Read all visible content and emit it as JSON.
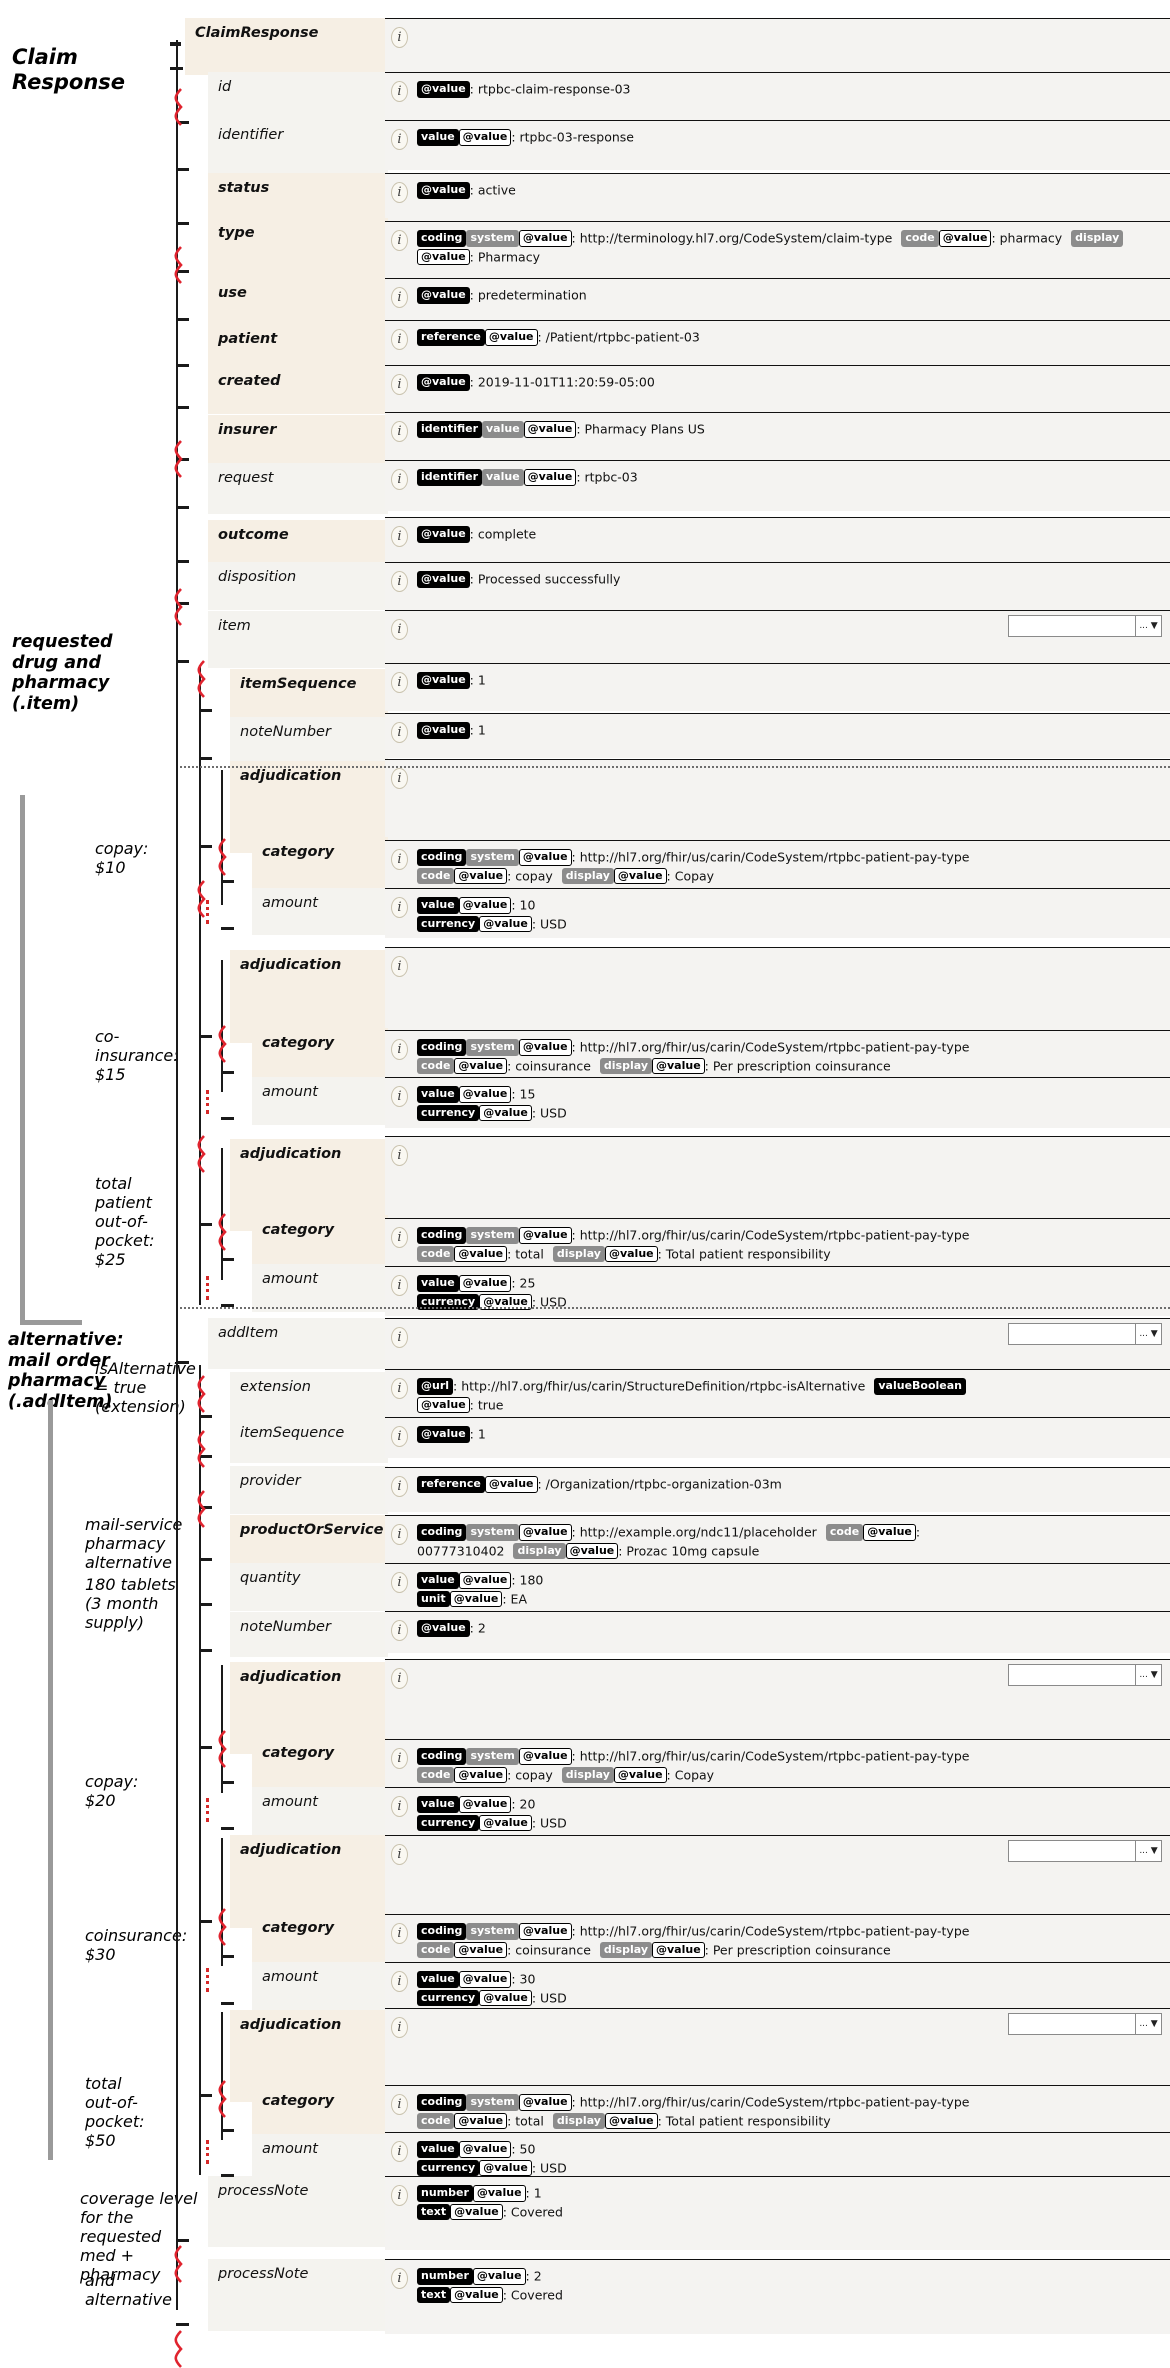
{
  "title": "ClaimResponse FHIR resource tree",
  "annotations": [
    {
      "id": "claim-response",
      "text": "Claim\nResponse",
      "size": "big"
    },
    {
      "id": "requested-drug",
      "text": "requested\ndrug and\npharmacy\n(.item)",
      "size": "mid"
    },
    {
      "id": "copay-10",
      "text": "copay:\n$10",
      "size": "sub"
    },
    {
      "id": "coinsurance-15",
      "text": "co-\ninsurance:\n$15",
      "size": "sub"
    },
    {
      "id": "total-oop-25",
      "text": "total\npatient\nout-of-\npocket:\n$25",
      "size": "sub"
    },
    {
      "id": "alternative",
      "text": "alternative:\nmail order\npharmacy\n(.addItem)",
      "size": "mid"
    },
    {
      "id": "is-alternative",
      "text": "isAlternative\n= true\n(extension)",
      "size": "sub"
    },
    {
      "id": "mail-service",
      "text": "mail-service\npharmacy\nalternative",
      "size": "sub"
    },
    {
      "id": "tablets-180",
      "text": "180 tablets\n(3 month\nsupply)",
      "size": "sub"
    },
    {
      "id": "copay-20",
      "text": "copay:\n$20",
      "size": "sub"
    },
    {
      "id": "coinsurance-30",
      "text": "coinsurance:\n$30",
      "size": "sub"
    },
    {
      "id": "total-oop-50",
      "text": "total\nout-of-\npocket:\n$50",
      "size": "sub"
    },
    {
      "id": "coverage-level",
      "text": "coverage level\nfor the\nrequested\nmed + pharmacy",
      "size": "sub"
    },
    {
      "id": "and-alternative",
      "text": "and\nalternative",
      "size": "sub"
    }
  ],
  "icons": {
    "info": "i",
    "dropdown_arrow": "... ▼"
  },
  "colors": {
    "badge_element": "#000000",
    "badge_attribute": "#8c8c8c",
    "badge_value_border": "#000000",
    "row_required": "#f6efe4",
    "row_optional": "#f4f3ef",
    "squiggle": "#d62828"
  },
  "rows": [
    {
      "name": "ClaimResponse",
      "style": "hdr",
      "parts": []
    },
    {
      "name": "id",
      "style": "opt",
      "parts": [
        {
          "t": "el",
          "v": "@value"
        },
        {
          "t": "txt",
          "v": ": rtpbc-claim-response-03"
        }
      ]
    },
    {
      "name": "identifier",
      "style": "opt",
      "parts": [
        {
          "t": "el",
          "v": "value"
        },
        {
          "t": "va",
          "v": "@value"
        },
        {
          "t": "txt",
          "v": ": rtpbc-03-response"
        }
      ]
    },
    {
      "name": "status",
      "style": "req",
      "parts": [
        {
          "t": "el",
          "v": "@value"
        },
        {
          "t": "txt",
          "v": ": active"
        }
      ]
    },
    {
      "name": "type",
      "style": "req",
      "parts": [
        {
          "t": "el",
          "v": "coding"
        },
        {
          "t": "at",
          "v": "system"
        },
        {
          "t": "va",
          "v": "@value"
        },
        {
          "t": "txt",
          "v": ": http://terminology.hl7.org/CodeSystem/claim-type"
        },
        {
          "t": "sep"
        },
        {
          "t": "at",
          "v": "code"
        },
        {
          "t": "va",
          "v": "@value"
        },
        {
          "t": "txt",
          "v": ": pharmacy"
        },
        {
          "t": "sep"
        },
        {
          "t": "at",
          "v": "display"
        },
        {
          "t": "va",
          "v": "@value"
        },
        {
          "t": "txt",
          "v": ": Pharmacy"
        }
      ]
    },
    {
      "name": "use",
      "style": "req",
      "parts": [
        {
          "t": "el",
          "v": "@value"
        },
        {
          "t": "txt",
          "v": ": predetermination"
        }
      ]
    },
    {
      "name": "patient",
      "style": "req",
      "parts": [
        {
          "t": "el",
          "v": "reference"
        },
        {
          "t": "va",
          "v": "@value"
        },
        {
          "t": "txt",
          "v": ": /Patient/rtpbc-patient-03"
        }
      ]
    },
    {
      "name": "created",
      "style": "req",
      "parts": [
        {
          "t": "el",
          "v": "@value"
        },
        {
          "t": "txt",
          "v": ": 2019-11-01T11:20:59-05:00"
        }
      ]
    },
    {
      "name": "insurer",
      "style": "req",
      "parts": [
        {
          "t": "el",
          "v": "identifier"
        },
        {
          "t": "at",
          "v": "value"
        },
        {
          "t": "va",
          "v": "@value"
        },
        {
          "t": "txt",
          "v": ": Pharmacy Plans US"
        }
      ]
    },
    {
      "name": "request",
      "style": "opt",
      "parts": [
        {
          "t": "el",
          "v": "identifier"
        },
        {
          "t": "at",
          "v": "value"
        },
        {
          "t": "va",
          "v": "@value"
        },
        {
          "t": "txt",
          "v": ": rtpbc-03"
        }
      ]
    },
    {
      "name": "outcome",
      "style": "req",
      "parts": [
        {
          "t": "el",
          "v": "@value"
        },
        {
          "t": "txt",
          "v": ": complete"
        }
      ]
    },
    {
      "name": "disposition",
      "style": "opt",
      "parts": [
        {
          "t": "el",
          "v": "@value"
        },
        {
          "t": "txt",
          "v": ": Processed successfully"
        }
      ]
    },
    {
      "name": "item",
      "style": "opt",
      "dropdown": true,
      "parts": []
    },
    {
      "name": "itemSequence",
      "style": "req",
      "parts": [
        {
          "t": "el",
          "v": "@value"
        },
        {
          "t": "txt",
          "v": ": 1"
        }
      ]
    },
    {
      "name": "noteNumber",
      "style": "opt",
      "parts": [
        {
          "t": "el",
          "v": "@value"
        },
        {
          "t": "txt",
          "v": ": 1"
        }
      ]
    },
    {
      "name": "adjudication",
      "style": "req",
      "parts": []
    },
    {
      "name": "category",
      "style": "req",
      "parts": [
        {
          "t": "el",
          "v": "coding"
        },
        {
          "t": "at",
          "v": "system"
        },
        {
          "t": "va",
          "v": "@value"
        },
        {
          "t": "txt",
          "v": ": http://hl7.org/fhir/us/carin/CodeSystem/rtpbc-patient-pay-type"
        },
        {
          "t": "br"
        },
        {
          "t": "at",
          "v": "code"
        },
        {
          "t": "va",
          "v": "@value"
        },
        {
          "t": "txt",
          "v": ": copay"
        },
        {
          "t": "sep"
        },
        {
          "t": "at",
          "v": "display"
        },
        {
          "t": "va",
          "v": "@value"
        },
        {
          "t": "txt",
          "v": ": Copay"
        }
      ]
    },
    {
      "name": "amount",
      "style": "opt",
      "parts": [
        {
          "t": "el",
          "v": "value"
        },
        {
          "t": "va",
          "v": "@value"
        },
        {
          "t": "txt",
          "v": ": 10"
        },
        {
          "t": "br"
        },
        {
          "t": "el",
          "v": "currency"
        },
        {
          "t": "va",
          "v": "@value"
        },
        {
          "t": "txt",
          "v": ": USD"
        }
      ]
    },
    {
      "name": "adjudication",
      "style": "req",
      "parts": []
    },
    {
      "name": "category",
      "style": "req",
      "parts": [
        {
          "t": "el",
          "v": "coding"
        },
        {
          "t": "at",
          "v": "system"
        },
        {
          "t": "va",
          "v": "@value"
        },
        {
          "t": "txt",
          "v": ": http://hl7.org/fhir/us/carin/CodeSystem/rtpbc-patient-pay-type"
        },
        {
          "t": "br"
        },
        {
          "t": "at",
          "v": "code"
        },
        {
          "t": "va",
          "v": "@value"
        },
        {
          "t": "txt",
          "v": ": coinsurance"
        },
        {
          "t": "sep"
        },
        {
          "t": "at",
          "v": "display"
        },
        {
          "t": "va",
          "v": "@value"
        },
        {
          "t": "txt",
          "v": ": Per prescription coinsurance"
        }
      ]
    },
    {
      "name": "amount",
      "style": "opt",
      "parts": [
        {
          "t": "el",
          "v": "value"
        },
        {
          "t": "va",
          "v": "@value"
        },
        {
          "t": "txt",
          "v": ": 15"
        },
        {
          "t": "br"
        },
        {
          "t": "el",
          "v": "currency"
        },
        {
          "t": "va",
          "v": "@value"
        },
        {
          "t": "txt",
          "v": ": USD"
        }
      ]
    },
    {
      "name": "adjudication",
      "style": "req",
      "parts": []
    },
    {
      "name": "category",
      "style": "req",
      "parts": [
        {
          "t": "el",
          "v": "coding"
        },
        {
          "t": "at",
          "v": "system"
        },
        {
          "t": "va",
          "v": "@value"
        },
        {
          "t": "txt",
          "v": ": http://hl7.org/fhir/us/carin/CodeSystem/rtpbc-patient-pay-type"
        },
        {
          "t": "br"
        },
        {
          "t": "at",
          "v": "code"
        },
        {
          "t": "va",
          "v": "@value"
        },
        {
          "t": "txt",
          "v": ": total"
        },
        {
          "t": "sep"
        },
        {
          "t": "at",
          "v": "display"
        },
        {
          "t": "va",
          "v": "@value"
        },
        {
          "t": "txt",
          "v": ": Total patient responsibility"
        }
      ]
    },
    {
      "name": "amount",
      "style": "opt",
      "parts": [
        {
          "t": "el",
          "v": "value"
        },
        {
          "t": "va",
          "v": "@value"
        },
        {
          "t": "txt",
          "v": ": 25"
        },
        {
          "t": "br"
        },
        {
          "t": "el",
          "v": "currency"
        },
        {
          "t": "va",
          "v": "@value"
        },
        {
          "t": "txt",
          "v": ": USD"
        }
      ]
    },
    {
      "name": "addItem",
      "style": "opt",
      "dropdown": true,
      "parts": []
    },
    {
      "name": "extension",
      "style": "opt",
      "parts": [
        {
          "t": "el",
          "v": "@url"
        },
        {
          "t": "txt",
          "v": ": http://hl7.org/fhir/us/carin/StructureDefinition/rtpbc-isAlternative"
        },
        {
          "t": "sep"
        },
        {
          "t": "el",
          "v": "valueBoolean"
        },
        {
          "t": "br"
        },
        {
          "t": "va",
          "v": "@value"
        },
        {
          "t": "txt",
          "v": ": true"
        }
      ]
    },
    {
      "name": "itemSequence",
      "style": "opt",
      "parts": [
        {
          "t": "el",
          "v": "@value"
        },
        {
          "t": "txt",
          "v": ": 1"
        }
      ]
    },
    {
      "name": "provider",
      "style": "opt",
      "parts": [
        {
          "t": "el",
          "v": "reference"
        },
        {
          "t": "va",
          "v": "@value"
        },
        {
          "t": "txt",
          "v": ": /Organization/rtpbc-organization-03m"
        }
      ]
    },
    {
      "name": "productOrService",
      "style": "req",
      "parts": [
        {
          "t": "el",
          "v": "coding"
        },
        {
          "t": "at",
          "v": "system"
        },
        {
          "t": "va",
          "v": "@value"
        },
        {
          "t": "txt",
          "v": ": http://example.org/ndc11/placeholder"
        },
        {
          "t": "sep"
        },
        {
          "t": "at",
          "v": "code"
        },
        {
          "t": "va",
          "v": "@value"
        },
        {
          "t": "txt",
          "v": ":"
        },
        {
          "t": "br"
        },
        {
          "t": "txt",
          "v": "00777310402"
        },
        {
          "t": "sep"
        },
        {
          "t": "at",
          "v": "display"
        },
        {
          "t": "va",
          "v": "@value"
        },
        {
          "t": "txt",
          "v": ": Prozac 10mg capsule"
        }
      ]
    },
    {
      "name": "quantity",
      "style": "opt",
      "parts": [
        {
          "t": "el",
          "v": "value"
        },
        {
          "t": "va",
          "v": "@value"
        },
        {
          "t": "txt",
          "v": ": 180"
        },
        {
          "t": "br"
        },
        {
          "t": "el",
          "v": "unit"
        },
        {
          "t": "va",
          "v": "@value"
        },
        {
          "t": "txt",
          "v": ": EA"
        }
      ]
    },
    {
      "name": "noteNumber",
      "style": "opt",
      "parts": [
        {
          "t": "el",
          "v": "@value"
        },
        {
          "t": "txt",
          "v": ": 2"
        }
      ]
    },
    {
      "name": "adjudication",
      "style": "req",
      "dropdown": true,
      "parts": []
    },
    {
      "name": "category",
      "style": "req",
      "parts": [
        {
          "t": "el",
          "v": "coding"
        },
        {
          "t": "at",
          "v": "system"
        },
        {
          "t": "va",
          "v": "@value"
        },
        {
          "t": "txt",
          "v": ": http://hl7.org/fhir/us/carin/CodeSystem/rtpbc-patient-pay-type"
        },
        {
          "t": "br"
        },
        {
          "t": "at",
          "v": "code"
        },
        {
          "t": "va",
          "v": "@value"
        },
        {
          "t": "txt",
          "v": ": copay"
        },
        {
          "t": "sep"
        },
        {
          "t": "at",
          "v": "display"
        },
        {
          "t": "va",
          "v": "@value"
        },
        {
          "t": "txt",
          "v": ": Copay"
        }
      ]
    },
    {
      "name": "amount",
      "style": "opt",
      "parts": [
        {
          "t": "el",
          "v": "value"
        },
        {
          "t": "va",
          "v": "@value"
        },
        {
          "t": "txt",
          "v": ": 20"
        },
        {
          "t": "br"
        },
        {
          "t": "el",
          "v": "currency"
        },
        {
          "t": "va",
          "v": "@value"
        },
        {
          "t": "txt",
          "v": ": USD"
        }
      ]
    },
    {
      "name": "adjudication",
      "style": "req",
      "dropdown": true,
      "parts": []
    },
    {
      "name": "category",
      "style": "req",
      "parts": [
        {
          "t": "el",
          "v": "coding"
        },
        {
          "t": "at",
          "v": "system"
        },
        {
          "t": "va",
          "v": "@value"
        },
        {
          "t": "txt",
          "v": ": http://hl7.org/fhir/us/carin/CodeSystem/rtpbc-patient-pay-type"
        },
        {
          "t": "br"
        },
        {
          "t": "at",
          "v": "code"
        },
        {
          "t": "va",
          "v": "@value"
        },
        {
          "t": "txt",
          "v": ": coinsurance"
        },
        {
          "t": "sep"
        },
        {
          "t": "at",
          "v": "display"
        },
        {
          "t": "va",
          "v": "@value"
        },
        {
          "t": "txt",
          "v": ": Per prescription coinsurance"
        }
      ]
    },
    {
      "name": "amount",
      "style": "opt",
      "parts": [
        {
          "t": "el",
          "v": "value"
        },
        {
          "t": "va",
          "v": "@value"
        },
        {
          "t": "txt",
          "v": ": 30"
        },
        {
          "t": "br"
        },
        {
          "t": "el",
          "v": "currency"
        },
        {
          "t": "va",
          "v": "@value"
        },
        {
          "t": "txt",
          "v": ": USD"
        }
      ]
    },
    {
      "name": "adjudication",
      "style": "req",
      "dropdown": true,
      "parts": []
    },
    {
      "name": "category",
      "style": "req",
      "parts": [
        {
          "t": "el",
          "v": "coding"
        },
        {
          "t": "at",
          "v": "system"
        },
        {
          "t": "va",
          "v": "@value"
        },
        {
          "t": "txt",
          "v": ": http://hl7.org/fhir/us/carin/CodeSystem/rtpbc-patient-pay-type"
        },
        {
          "t": "br"
        },
        {
          "t": "at",
          "v": "code"
        },
        {
          "t": "va",
          "v": "@value"
        },
        {
          "t": "txt",
          "v": ": total"
        },
        {
          "t": "sep"
        },
        {
          "t": "at",
          "v": "display"
        },
        {
          "t": "va",
          "v": "@value"
        },
        {
          "t": "txt",
          "v": ": Total patient responsibility"
        }
      ]
    },
    {
      "name": "amount",
      "style": "opt",
      "parts": [
        {
          "t": "el",
          "v": "value"
        },
        {
          "t": "va",
          "v": "@value"
        },
        {
          "t": "txt",
          "v": ": 50"
        },
        {
          "t": "br"
        },
        {
          "t": "el",
          "v": "currency"
        },
        {
          "t": "va",
          "v": "@value"
        },
        {
          "t": "txt",
          "v": ": USD"
        }
      ]
    },
    {
      "name": "processNote",
      "style": "opt",
      "parts": [
        {
          "t": "el",
          "v": "number"
        },
        {
          "t": "va",
          "v": "@value"
        },
        {
          "t": "txt",
          "v": ": 1"
        },
        {
          "t": "br"
        },
        {
          "t": "el",
          "v": "text"
        },
        {
          "t": "va",
          "v": "@value"
        },
        {
          "t": "txt",
          "v": ": Covered"
        }
      ]
    },
    {
      "name": "processNote",
      "style": "opt",
      "parts": [
        {
          "t": "el",
          "v": "number"
        },
        {
          "t": "va",
          "v": "@value"
        },
        {
          "t": "txt",
          "v": ": 2"
        },
        {
          "t": "br"
        },
        {
          "t": "el",
          "v": "text"
        },
        {
          "t": "va",
          "v": "@value"
        },
        {
          "t": "txt",
          "v": ": Covered"
        }
      ]
    }
  ]
}
